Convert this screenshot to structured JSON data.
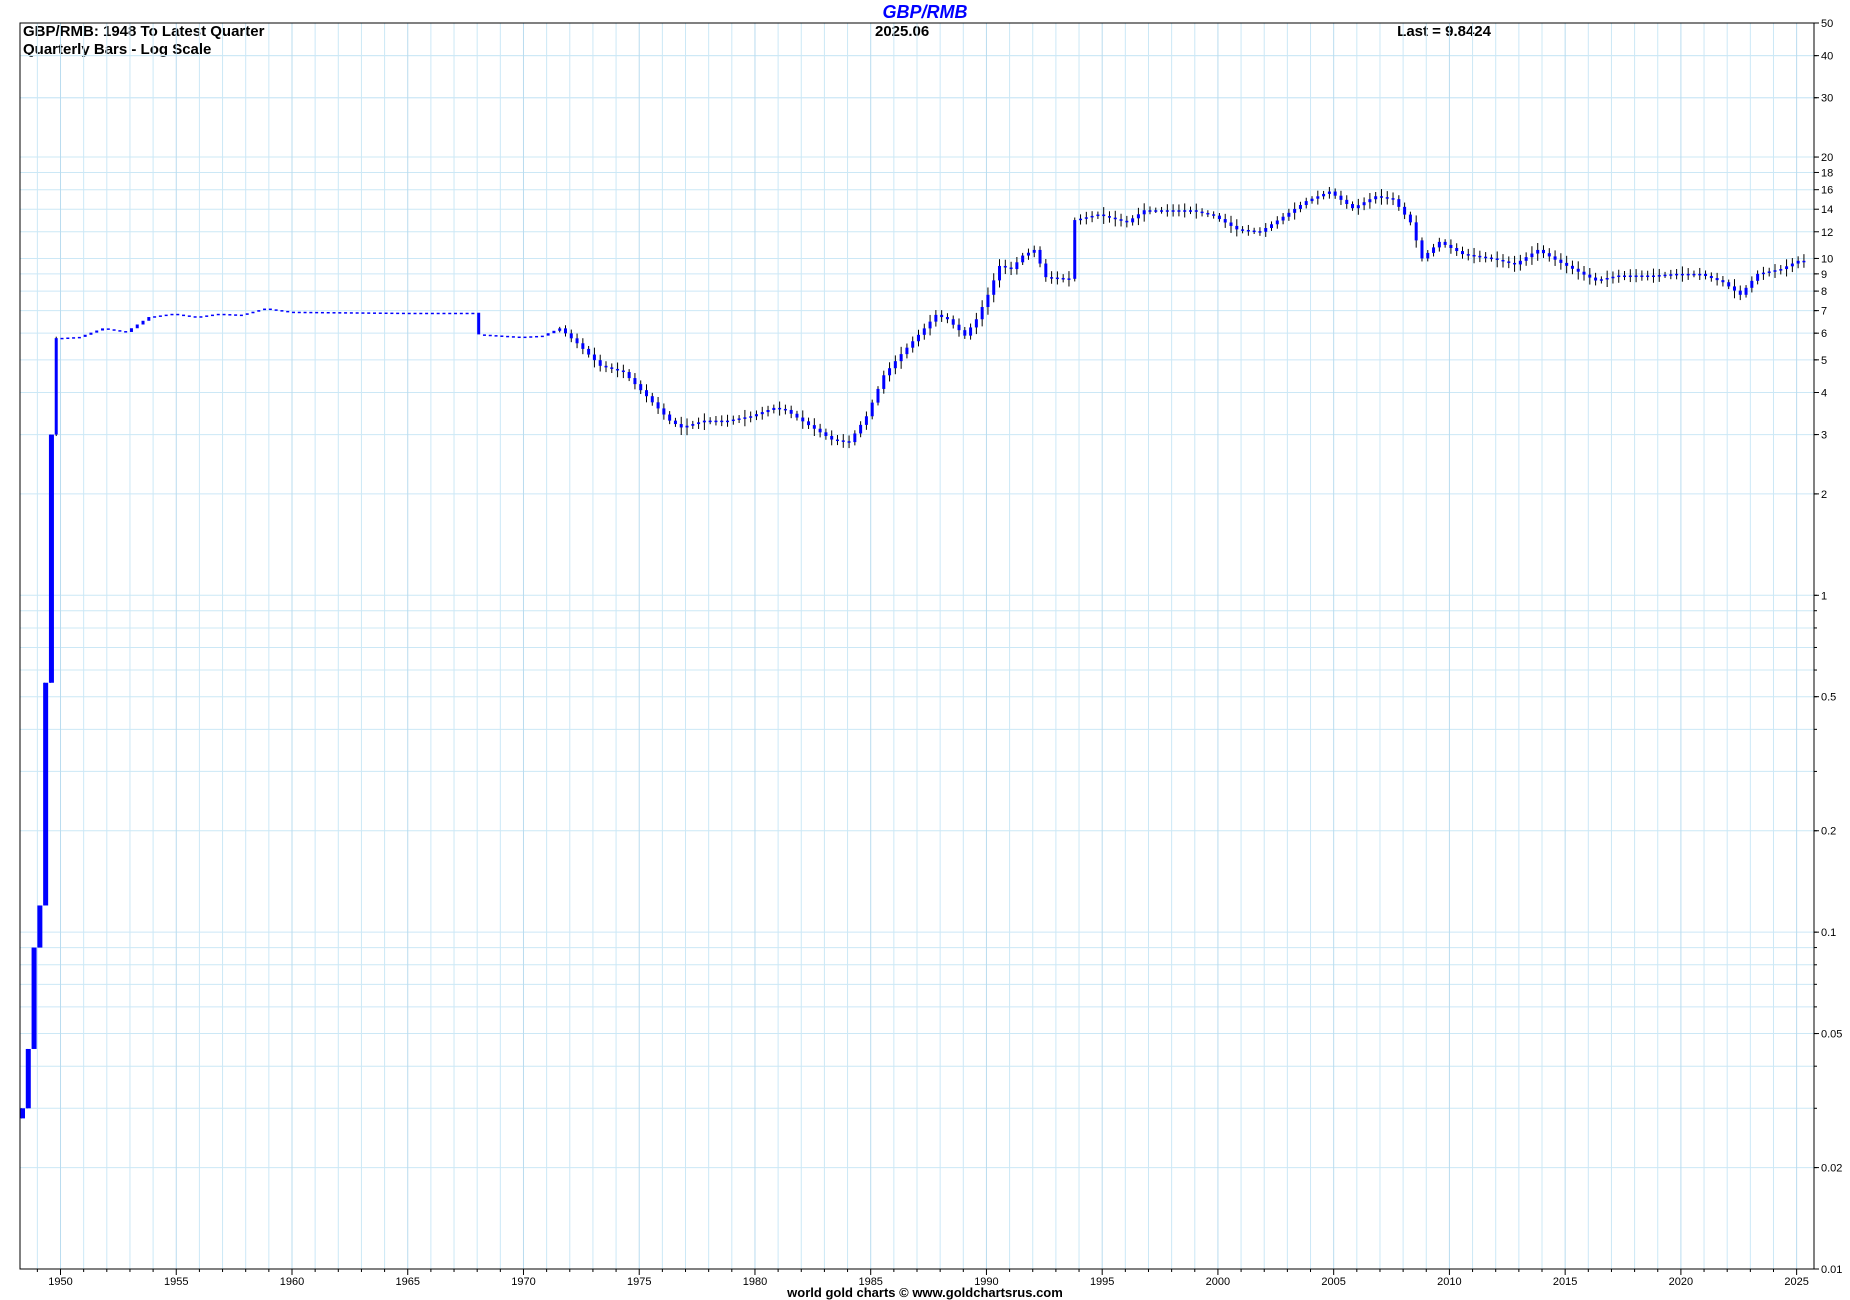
{
  "chart_data": {
    "type": "ohlc",
    "title": "GBP/RMB",
    "subtitle_line1": "GBP/RMB: 1948 To Latest Quarter",
    "subtitle_line2": "Quarterly Bars - Log Scale",
    "date_label": "2025.06",
    "last_label": "Last = 9.8424",
    "credit": "world gold charts © www.goldchartsrus.com",
    "y_scale": "log",
    "ylim": [
      0.01,
      50
    ],
    "xlim": [
      1948.25,
      2025.75
    ],
    "grid": true,
    "colors": {
      "bars": "#0000ff",
      "grid": "#cce8f6",
      "axis": "#000000",
      "wick": "#000000"
    },
    "y_ticks": [
      {
        "value": 0.01,
        "label": "0.01"
      },
      {
        "value": 0.02,
        "label": "0.02"
      },
      {
        "value": 0.05,
        "label": "0.05"
      },
      {
        "value": 0.1,
        "label": "0.1"
      },
      {
        "value": 0.2,
        "label": "0.2"
      },
      {
        "value": 0.5,
        "label": "0.5"
      },
      {
        "value": 1,
        "label": "1"
      },
      {
        "value": 2,
        "label": "2"
      },
      {
        "value": 3,
        "label": "3"
      },
      {
        "value": 4,
        "label": "4"
      },
      {
        "value": 5,
        "label": "5"
      },
      {
        "value": 6,
        "label": "6"
      },
      {
        "value": 7,
        "label": "7"
      },
      {
        "value": 8,
        "label": "8"
      },
      {
        "value": 9,
        "label": "9"
      },
      {
        "value": 10,
        "label": "10"
      },
      {
        "value": 12,
        "label": "12"
      },
      {
        "value": 14,
        "label": "14"
      },
      {
        "value": 16,
        "label": "16"
      },
      {
        "value": 18,
        "label": "18"
      },
      {
        "value": 20,
        "label": "20"
      },
      {
        "value": 30,
        "label": "30"
      },
      {
        "value": 40,
        "label": "40"
      },
      {
        "value": 50,
        "label": "50"
      }
    ],
    "x_ticks": [
      {
        "value": 1950,
        "label": "1950"
      },
      {
        "value": 1955,
        "label": "1955"
      },
      {
        "value": 1960,
        "label": "1960"
      },
      {
        "value": 1965,
        "label": "1965"
      },
      {
        "value": 1970,
        "label": "1970"
      },
      {
        "value": 1975,
        "label": "1975"
      },
      {
        "value": 1980,
        "label": "1980"
      },
      {
        "value": 1985,
        "label": "1985"
      },
      {
        "value": 1990,
        "label": "1990"
      },
      {
        "value": 1995,
        "label": "1995"
      },
      {
        "value": 2000,
        "label": "2000"
      },
      {
        "value": 2005,
        "label": "2005"
      },
      {
        "value": 2010,
        "label": "2010"
      },
      {
        "value": 2015,
        "label": "2015"
      },
      {
        "value": 2020,
        "label": "2020"
      },
      {
        "value": 2025,
        "label": "2025"
      }
    ],
    "anchors": [
      [
        1948.25,
        0.028
      ],
      [
        1948.5,
        0.03
      ],
      [
        1948.75,
        0.045
      ],
      [
        1949.0,
        0.09
      ],
      [
        1949.25,
        0.12
      ],
      [
        1949.5,
        0.55
      ],
      [
        1949.75,
        3.0
      ],
      [
        1950.0,
        5.8
      ],
      [
        1951.0,
        5.85
      ],
      [
        1952.0,
        6.2
      ],
      [
        1953.0,
        6.05
      ],
      [
        1954.0,
        6.7
      ],
      [
        1955.0,
        6.85
      ],
      [
        1956.0,
        6.7
      ],
      [
        1957.0,
        6.85
      ],
      [
        1958.0,
        6.8
      ],
      [
        1959.0,
        7.1
      ],
      [
        1960.0,
        6.95
      ],
      [
        1965.0,
        6.9
      ],
      [
        1968.0,
        6.9
      ],
      [
        1968.25,
        5.95
      ],
      [
        1970.0,
        5.85
      ],
      [
        1971.0,
        5.9
      ],
      [
        1971.75,
        6.2
      ],
      [
        1972.5,
        5.6
      ],
      [
        1973.5,
        4.8
      ],
      [
        1974.5,
        4.6
      ],
      [
        1975.5,
        3.9
      ],
      [
        1976.5,
        3.3
      ],
      [
        1977.0,
        3.15
      ],
      [
        1978.0,
        3.3
      ],
      [
        1979.0,
        3.3
      ],
      [
        1980.0,
        3.4
      ],
      [
        1981.0,
        3.6
      ],
      [
        1981.5,
        3.55
      ],
      [
        1982.5,
        3.2
      ],
      [
        1983.5,
        2.9
      ],
      [
        1984.25,
        2.85
      ],
      [
        1985.0,
        3.4
      ],
      [
        1985.75,
        4.5
      ],
      [
        1986.5,
        5.2
      ],
      [
        1987.5,
        6.2
      ],
      [
        1988.0,
        6.8
      ],
      [
        1988.5,
        6.6
      ],
      [
        1989.25,
        5.9
      ],
      [
        1989.75,
        6.6
      ],
      [
        1990.25,
        7.8
      ],
      [
        1990.75,
        9.5
      ],
      [
        1991.25,
        9.3
      ],
      [
        1991.75,
        10.2
      ],
      [
        1992.25,
        10.6
      ],
      [
        1992.75,
        8.8
      ],
      [
        1993.75,
        8.7
      ],
      [
        1994.0,
        13.0
      ],
      [
        1995.0,
        13.5
      ],
      [
        1996.25,
        12.8
      ],
      [
        1997.0,
        13.9
      ],
      [
        1999.0,
        13.9
      ],
      [
        2000.0,
        13.4
      ],
      [
        2001.0,
        12.2
      ],
      [
        2002.0,
        12.0
      ],
      [
        2003.0,
        13.3
      ],
      [
        2004.0,
        14.8
      ],
      [
        2005.0,
        15.8
      ],
      [
        2006.0,
        14.1
      ],
      [
        2007.0,
        15.3
      ],
      [
        2007.75,
        15.0
      ],
      [
        2008.5,
        12.8
      ],
      [
        2009.0,
        10.0
      ],
      [
        2009.75,
        11.2
      ],
      [
        2010.75,
        10.3
      ],
      [
        2012.0,
        10.0
      ],
      [
        2013.0,
        9.6
      ],
      [
        2014.0,
        10.6
      ],
      [
        2015.0,
        9.7
      ],
      [
        2016.5,
        8.6
      ],
      [
        2017.5,
        8.9
      ],
      [
        2019.0,
        8.9
      ],
      [
        2020.0,
        9.0
      ],
      [
        2021.0,
        9.0
      ],
      [
        2022.0,
        8.5
      ],
      [
        2022.75,
        7.8
      ],
      [
        2023.5,
        9.0
      ],
      [
        2024.5,
        9.3
      ],
      [
        2025.25,
        9.84
      ]
    ]
  }
}
